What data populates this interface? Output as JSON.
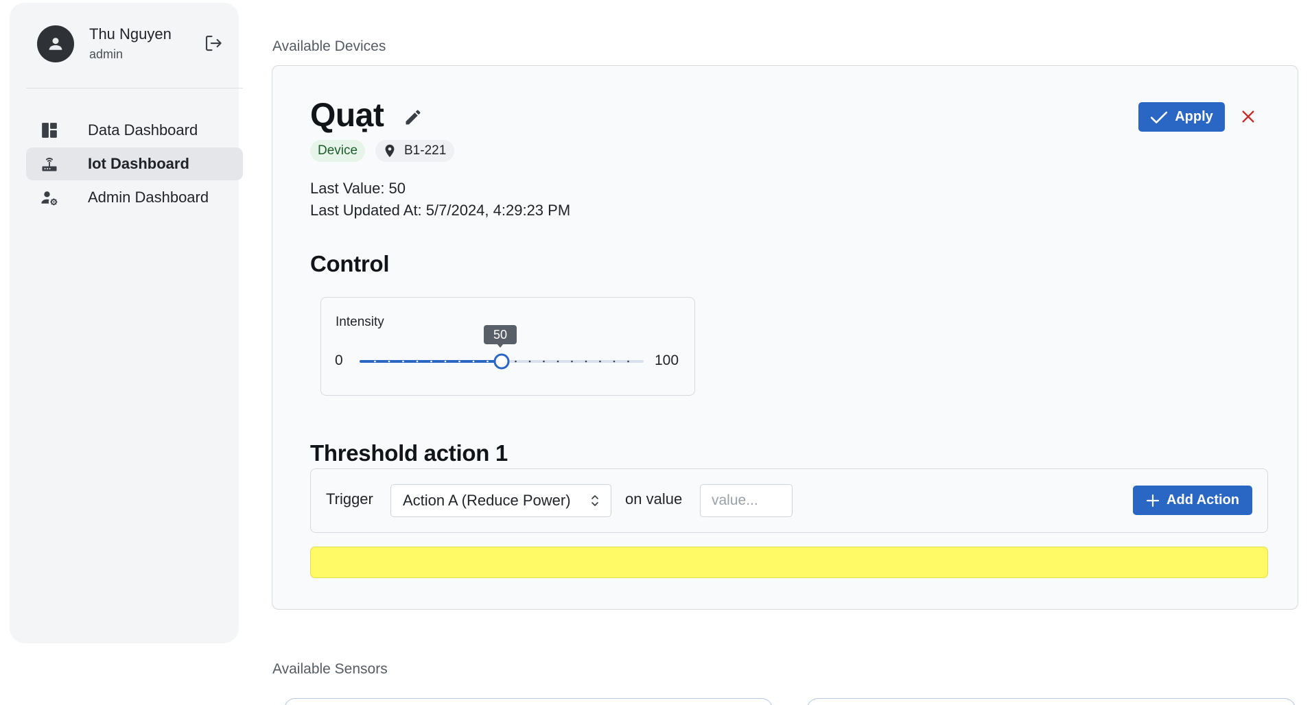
{
  "user": {
    "name": "Thu Nguyen",
    "role": "admin"
  },
  "nav": {
    "items": [
      {
        "label": "Data Dashboard",
        "icon": "dashboard-icon"
      },
      {
        "label": "Iot Dashboard",
        "icon": "router-icon",
        "active": true
      },
      {
        "label": "Admin Dashboard",
        "icon": "admin-settings-icon"
      }
    ]
  },
  "sections": {
    "devices": "Available Devices",
    "sensors": "Available Sensors"
  },
  "device": {
    "name": "Quạt",
    "type": "Device",
    "location": "B1-221",
    "last_value": "Last Value: 50",
    "last_updated": "Last Updated At: 5/7/2024, 4:29:23 PM",
    "apply_label": "Apply"
  },
  "control": {
    "heading": "Control",
    "intensity_label": "Intensity",
    "min": "0",
    "max": "100",
    "value": 50,
    "value_label": "50"
  },
  "threshold": {
    "heading": "Threshold action 1",
    "trigger_label": "Trigger",
    "selected_action": "Action A (Reduce Power)",
    "on_value_label": "on value",
    "value_placeholder": "value...",
    "add_label": "Add Action"
  },
  "colors": {
    "accent": "#2a66c4",
    "warning_bar": "#fffa66",
    "type_chip": "#e6f4ea",
    "close": "#c62828"
  }
}
